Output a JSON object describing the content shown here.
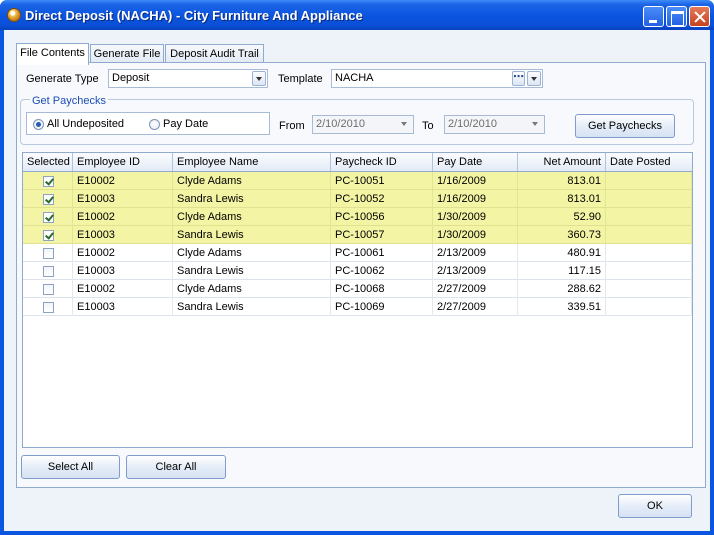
{
  "window": {
    "title": "Direct Deposit (NACHA) - City Furniture And Appliance"
  },
  "tabs": [
    {
      "label": "File Contents",
      "active": true
    },
    {
      "label": "Generate File",
      "active": false
    },
    {
      "label": "Deposit Audit Trail",
      "active": false
    }
  ],
  "form": {
    "generate_type_label": "Generate Type",
    "generate_type_value": "Deposit",
    "template_label": "Template",
    "template_value": "NACHA",
    "template_browse": "⋯"
  },
  "get_paychecks": {
    "group_title": "Get Paychecks",
    "option_all": "All Undeposited",
    "option_pay_date": "Pay Date",
    "selected_option": "All Undeposited",
    "from_label": "From",
    "from_value": "2/10/2010",
    "to_label": "To",
    "to_value": "2/10/2010",
    "button_label": "Get Paychecks"
  },
  "grid": {
    "columns": [
      "Selected",
      "Employee ID",
      "Employee Name",
      "Paycheck ID",
      "Pay Date",
      "Net Amount",
      "Date Posted"
    ],
    "rows": [
      {
        "selected": true,
        "employee_id": "E10002",
        "employee_name": "Clyde Adams",
        "paycheck_id": "PC-10051",
        "pay_date": "1/16/2009",
        "net_amount": "813.01",
        "date_posted": ""
      },
      {
        "selected": true,
        "employee_id": "E10003",
        "employee_name": "Sandra Lewis",
        "paycheck_id": "PC-10052",
        "pay_date": "1/16/2009",
        "net_amount": "813.01",
        "date_posted": ""
      },
      {
        "selected": true,
        "employee_id": "E10002",
        "employee_name": "Clyde Adams",
        "paycheck_id": "PC-10056",
        "pay_date": "1/30/2009",
        "net_amount": "52.90",
        "date_posted": ""
      },
      {
        "selected": true,
        "employee_id": "E10003",
        "employee_name": "Sandra Lewis",
        "paycheck_id": "PC-10057",
        "pay_date": "1/30/2009",
        "net_amount": "360.73",
        "date_posted": ""
      },
      {
        "selected": false,
        "employee_id": "E10002",
        "employee_name": "Clyde Adams",
        "paycheck_id": "PC-10061",
        "pay_date": "2/13/2009",
        "net_amount": "480.91",
        "date_posted": ""
      },
      {
        "selected": false,
        "employee_id": "E10003",
        "employee_name": "Sandra Lewis",
        "paycheck_id": "PC-10062",
        "pay_date": "2/13/2009",
        "net_amount": "117.15",
        "date_posted": ""
      },
      {
        "selected": false,
        "employee_id": "E10002",
        "employee_name": "Clyde Adams",
        "paycheck_id": "PC-10068",
        "pay_date": "2/27/2009",
        "net_amount": "288.62",
        "date_posted": ""
      },
      {
        "selected": false,
        "employee_id": "E10003",
        "employee_name": "Sandra Lewis",
        "paycheck_id": "PC-10069",
        "pay_date": "2/27/2009",
        "net_amount": "339.51",
        "date_posted": ""
      }
    ]
  },
  "buttons": {
    "select_all": "Select All",
    "clear_all": "Clear All",
    "ok": "OK"
  },
  "colors": {
    "title_bar": "#0a54e0",
    "selected_row": "#f3f5a5",
    "group_title": "#1c4db3"
  }
}
